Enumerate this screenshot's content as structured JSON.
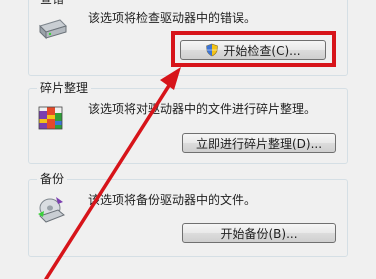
{
  "error_check": {
    "title": "查错",
    "description": "该选项将检查驱动器中的错误。",
    "button_label": "开始检查(C)..."
  },
  "defrag": {
    "title": "碎片整理",
    "description": "该选项将对驱动器中的文件进行碎片整理。",
    "button_label": "立即进行碎片整理(D)..."
  },
  "backup": {
    "title": "备份",
    "description": "该选项将备份驱动器中的文件。",
    "button_label": "开始备份(B)..."
  },
  "annotation": {
    "color": "#d7141a"
  }
}
